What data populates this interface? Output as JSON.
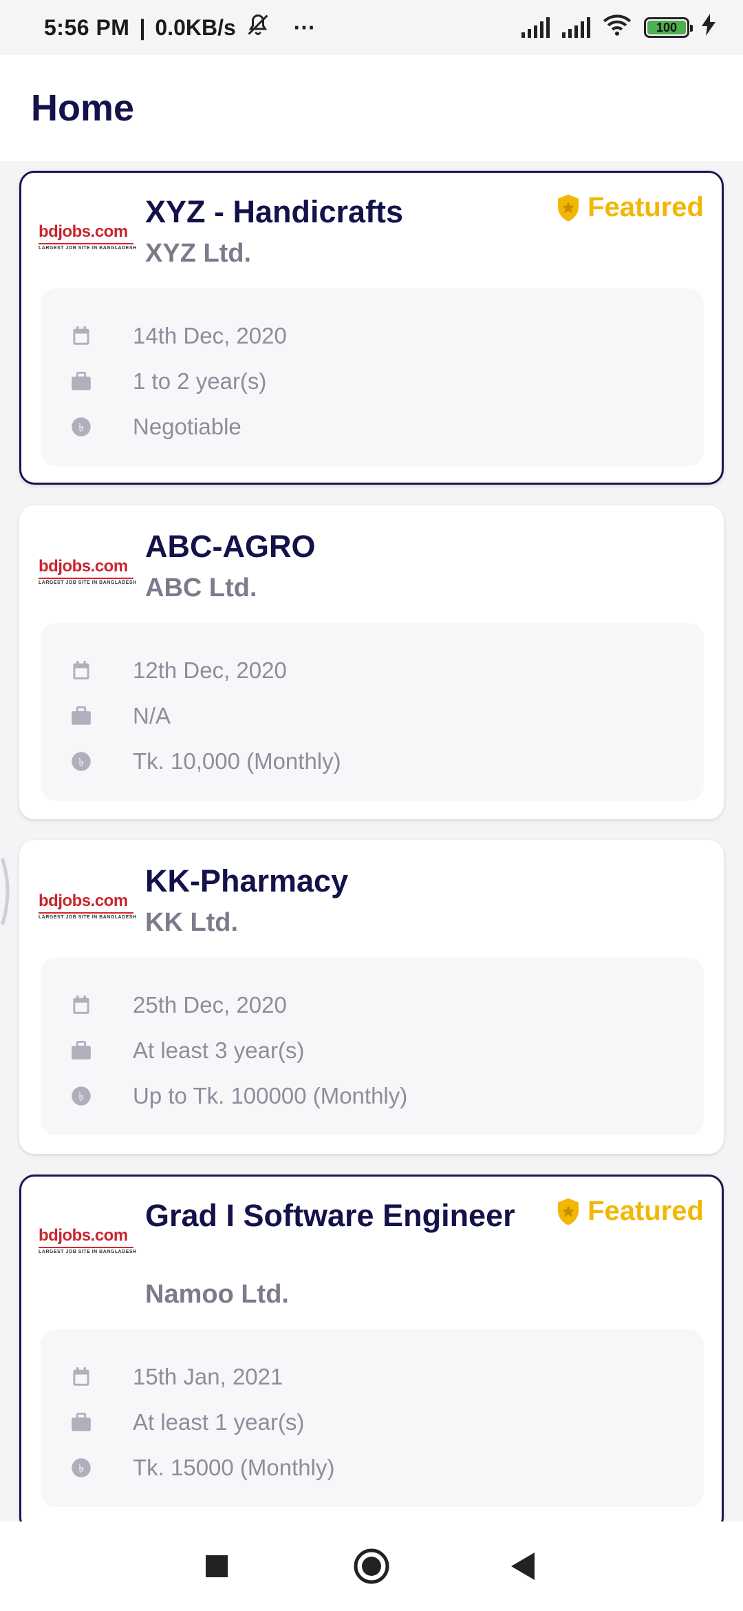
{
  "status_bar": {
    "time": "5:56 PM",
    "speed": "0.0KB/s",
    "more": "···",
    "battery": "100"
  },
  "header": {
    "title": "Home"
  },
  "logo": {
    "word": "bdjobs.com",
    "tagline": "LARGEST JOB SITE IN BANGLADESH"
  },
  "jobs": [
    {
      "title": "XYZ - Handicrafts",
      "company": "XYZ Ltd.",
      "featured": true,
      "badge_label": "Featured",
      "deadline": "14th Dec, 2020",
      "experience": "1 to 2 year(s)",
      "salary": "Negotiable"
    },
    {
      "title": "ABC-AGRO",
      "company": "ABC Ltd.",
      "featured": false,
      "deadline": "12th Dec, 2020",
      "experience": "N/A",
      "salary": "Tk. 10,000 (Monthly)"
    },
    {
      "title": "KK-Pharmacy",
      "company": "KK Ltd.",
      "featured": false,
      "deadline": "25th Dec, 2020",
      "experience": "At least 3 year(s)",
      "salary": "Up to Tk. 100000 (Monthly)"
    },
    {
      "title": "Grad I Software Engineer",
      "company": "Namoo Ltd.",
      "featured": true,
      "badge_label": "Featured",
      "deadline": "15th Jan, 2021",
      "experience": "At least 1 year(s)",
      "salary": "Tk. 15000 (Monthly)"
    }
  ],
  "colors": {
    "primary_navy": "#13124a",
    "featured_gold": "#f2b705",
    "muted_text": "#8d8d9c",
    "company_gray": "#7b7b8c"
  },
  "icons": {
    "deadline": "calendar-icon",
    "experience": "briefcase-icon",
    "salary": "taka-coin-icon",
    "featured": "shield-star-icon"
  }
}
